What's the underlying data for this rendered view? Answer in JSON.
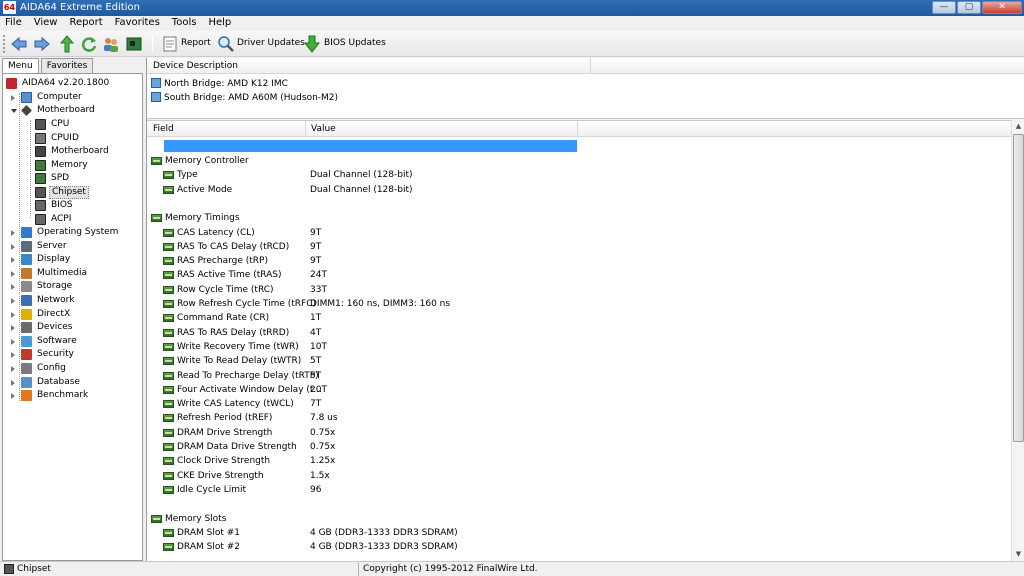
{
  "window": {
    "title": "AIDA64 Extreme Edition",
    "icon_text": "64",
    "btn_min": "—",
    "btn_max": "▢",
    "btn_close": "✕"
  },
  "menu": [
    "File",
    "View",
    "Report",
    "Favorites",
    "Tools",
    "Help"
  ],
  "toolbar": {
    "report": "Report",
    "driver_updates": "Driver Updates",
    "bios_updates": "BIOS Updates"
  },
  "tabs": {
    "menu": "Menu",
    "favorites": "Favorites"
  },
  "tree": {
    "root": "AIDA64 v2.20.1800",
    "top": [
      "Computer",
      "Motherboard"
    ],
    "motherboard_children": [
      "CPU",
      "CPUID",
      "Motherboard",
      "Memory",
      "SPD",
      "Chipset",
      "BIOS",
      "ACPI"
    ],
    "rest": [
      "Operating System",
      "Server",
      "Display",
      "Multimedia",
      "Storage",
      "Network",
      "DirectX",
      "Devices",
      "Software",
      "Security",
      "Config",
      "Database",
      "Benchmark"
    ]
  },
  "device_header": "Device Description",
  "devices": [
    "North Bridge: AMD K12 IMC",
    "South Bridge: AMD A60M (Hudson-M2)"
  ],
  "grid_header": {
    "field": "Field",
    "value": "Value"
  },
  "sections": [
    {
      "title": "Memory Controller",
      "rows": [
        {
          "field": "Type",
          "value": "Dual Channel  (128-bit)"
        },
        {
          "field": "Active Mode",
          "value": "Dual Channel  (128-bit)"
        }
      ]
    },
    {
      "title": "Memory Timings",
      "rows": [
        {
          "field": "CAS Latency (CL)",
          "value": "9T"
        },
        {
          "field": "RAS To CAS Delay (tRCD)",
          "value": "9T"
        },
        {
          "field": "RAS Precharge (tRP)",
          "value": "9T"
        },
        {
          "field": "RAS Active Time (tRAS)",
          "value": "24T"
        },
        {
          "field": "Row Cycle Time (tRC)",
          "value": "33T"
        },
        {
          "field": "Row Refresh Cycle Time (tRFC)",
          "value": "DIMM1: 160 ns, DIMM3: 160 ns"
        },
        {
          "field": "Command Rate (CR)",
          "value": "1T"
        },
        {
          "field": "RAS To RAS Delay (tRRD)",
          "value": "4T"
        },
        {
          "field": "Write Recovery Time (tWR)",
          "value": "10T"
        },
        {
          "field": "Write To Read Delay (tWTR)",
          "value": "5T"
        },
        {
          "field": "Read To Precharge Delay (tRTP)",
          "value": "5T"
        },
        {
          "field": "Four Activate Window Delay (t...",
          "value": "20T"
        },
        {
          "field": "Write CAS Latency (tWCL)",
          "value": "7T"
        },
        {
          "field": "Refresh Period (tREF)",
          "value": "7.8 us"
        },
        {
          "field": "DRAM Drive Strength",
          "value": "0.75x"
        },
        {
          "field": "DRAM Data Drive Strength",
          "value": "0.75x"
        },
        {
          "field": "Clock Drive Strength",
          "value": "1.25x"
        },
        {
          "field": "CKE Drive Strength",
          "value": "1.5x"
        },
        {
          "field": "Idle Cycle Limit",
          "value": "96"
        }
      ]
    },
    {
      "title": "Memory Slots",
      "rows": [
        {
          "field": "DRAM Slot #1",
          "value": "4 GB  (DDR3-1333 DDR3 SDRAM)"
        },
        {
          "field": "DRAM Slot #2",
          "value": "4 GB  (DDR3-1333 DDR3 SDRAM)"
        }
      ]
    }
  ],
  "status": {
    "left": "Chipset",
    "right": "Copyright (c) 1995-2012 FinalWire Ltd."
  },
  "colors": {
    "selection": "#3399ff",
    "titlebar": "#1d5aa0"
  }
}
